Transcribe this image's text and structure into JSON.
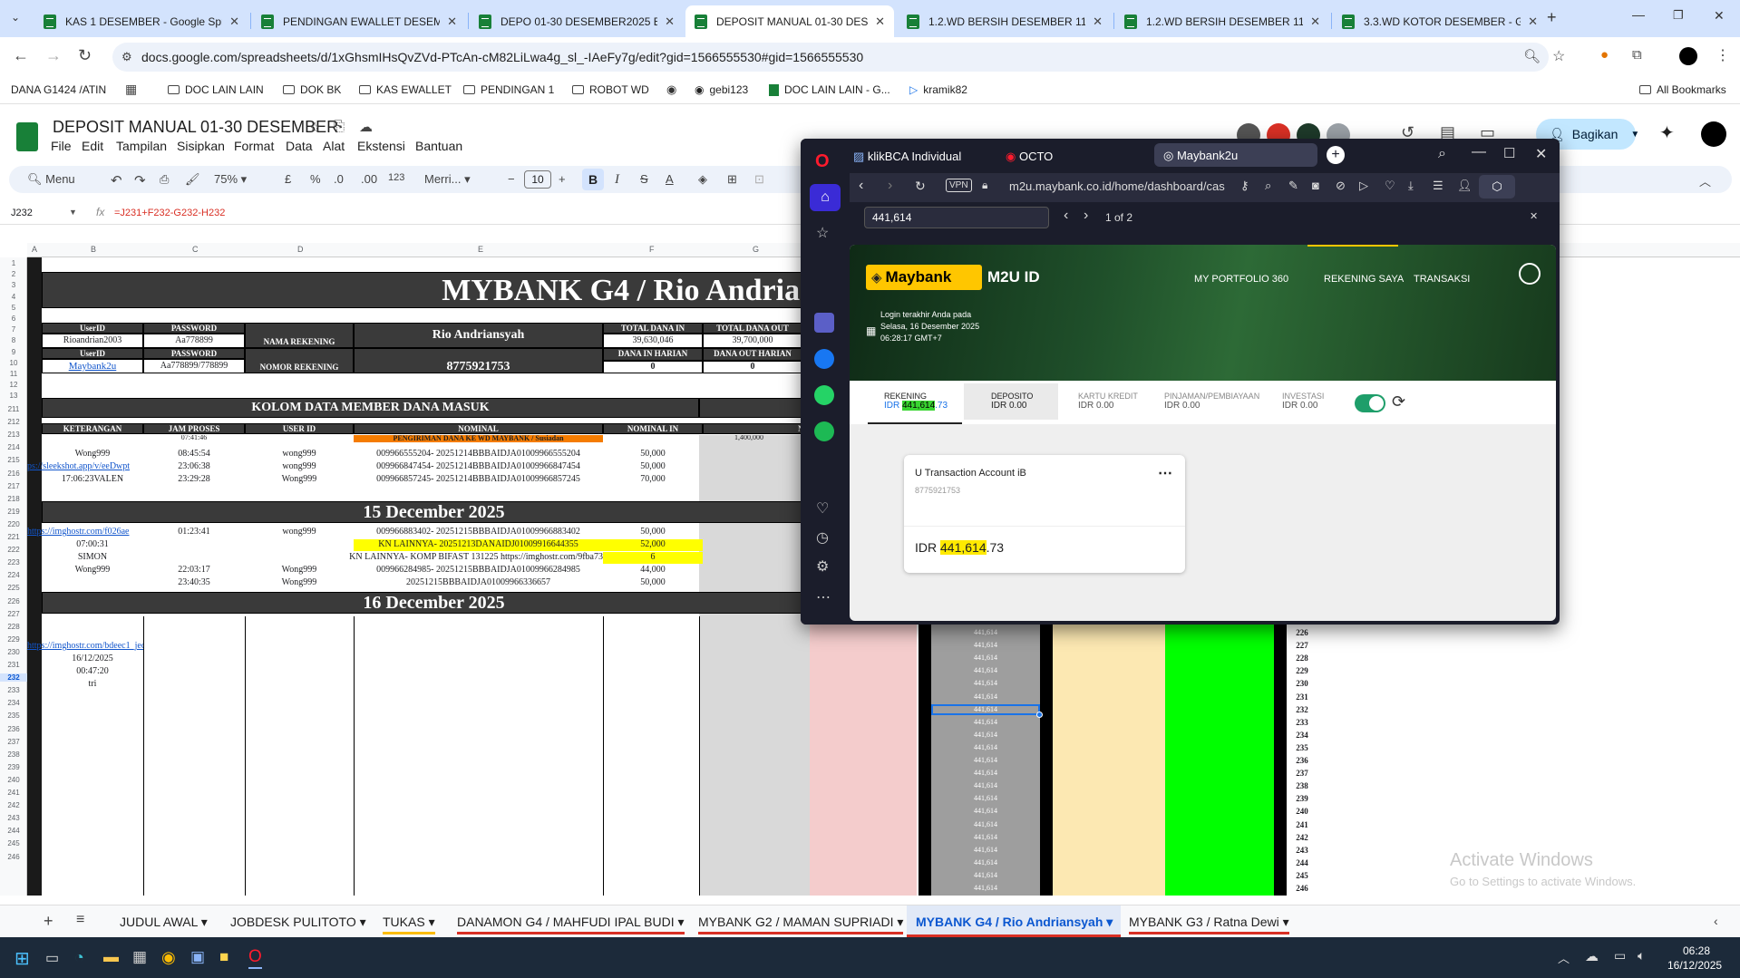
{
  "browser": {
    "tabs": [
      {
        "title": "KAS 1 DESEMBER - Google Spre"
      },
      {
        "title": "PENDINGAN EWALLET DESEMBE"
      },
      {
        "title": "DEPO 01-30 DESEMBER2025 BY"
      },
      {
        "title": "DEPOSIT MANUAL 01-30 DESEM"
      },
      {
        "title": "1.2.WD BERSIH DESEMBER 11 D"
      },
      {
        "title": "1.2.WD BERSIH DESEMBER 11 D"
      },
      {
        "title": "3.3.WD KOTOR DESEMBER - Go"
      }
    ],
    "url": "docs.google.com/spreadsheets/d/1xGhsmIHsQvZVd-PTcAn-cM82LiLwa4g_sl_-IAeFy7g/edit?gid=1566555530#gid=1566555530",
    "bookmarks": [
      "DANA G1424 /ATIN",
      "DOC LAIN LAIN",
      "DOK BK",
      "KAS EWALLET",
      "PENDINGAN 1",
      "ROBOT WD",
      "gebi123",
      "DOC LAIN LAIN - G...",
      "kramik82",
      "All Bookmarks"
    ]
  },
  "sheets": {
    "title": "DEPOSIT MANUAL 01-30 DESEMBER",
    "menu": [
      "File",
      "Edit",
      "Tampilan",
      "Sisipkan",
      "Format",
      "Data",
      "Alat",
      "Ekstensi",
      "Bantuan"
    ],
    "share_label": "Bagikan",
    "toolbar": {
      "menu": "Menu",
      "zoom": "75%",
      "currency": "£",
      "percent": "%",
      "dec_minus": ".0",
      "dec_plus": ".00",
      "number": "123",
      "font": "Merri...",
      "font_size": "10"
    },
    "cell_ref": "J232",
    "formula": "=J231+F232-G232-H232",
    "columns": [
      "A",
      "B",
      "C",
      "D",
      "E",
      "F",
      "G"
    ],
    "header": {
      "bank_title": "MYBANK G4 / Rio Andrian",
      "userid_label": "UserID",
      "password_label": "PASSWORD",
      "userid": "Rioandrian2003",
      "password": "Aa778899",
      "nama_label": "NAMA REKENING",
      "nama": "Rio Andriansyah",
      "total_in_label": "TOTAL DANA IN",
      "total_in": "39,630,046",
      "total_out_label": "TOTAL DANA OUT",
      "total_out": "39,700,000",
      "userid2_label": "UserID",
      "password2_label": "PASSWORD",
      "link": "Maybank2u",
      "password2": "Aa778899/778899",
      "nomor_label": "NOMOR REKENING",
      "nomor": "8775921753",
      "harian_in_label": "DANA IN HARIAN",
      "harian_in": "0",
      "harian_out_label": "DANA OUT HARIAN",
      "harian_out": "0"
    },
    "kolom_title": "KOLOM DATA MEMBER DANA MASUK",
    "col_labels": [
      "KETERANGAN",
      "JAM PROSES",
      "USER ID",
      "NOMINAL",
      "NOMINAL IN",
      "NOM"
    ],
    "rows_a": [
      {
        "b": "",
        "c": "07:41:46",
        "d": "",
        "e": "PENGIRIMAN DANA KE WD MAYBANK / Susiadan",
        "f": "",
        "g": "1,400,000"
      },
      {
        "b": "Wong999",
        "c": "08:45:54",
        "d": "wong999",
        "e": "009966555204- 20251214BBBAIDJA01009966555204",
        "f": "50,000",
        "g": ""
      },
      {
        "b": "ps://sleekshot.app/v/eeDwpt",
        "c": "23:06:38",
        "d": "wong999",
        "e": "009966847454- 20251214BBBAIDJA01009966847454",
        "f": "50,000",
        "g": ""
      },
      {
        "b": "17:06:23VALEN",
        "c": "23:29:28",
        "d": "Wong999",
        "e": "009966857245- 20251214BBBAIDJA01009966857245",
        "f": "70,000",
        "g": ""
      }
    ],
    "date1": "15 December 2025",
    "rows_b": [
      {
        "b": "https://imghostr.com/f026ae",
        "c": "01:23:41",
        "d": "wong999",
        "e": "009966883402- 20251215BBBAIDJA01009966883402",
        "f": "50,000"
      },
      {
        "b": "07:00:31",
        "c": "",
        "d": "",
        "e": "KN LAINNYA- 20251213DANAIDJ01009916644355",
        "f": "52,000"
      },
      {
        "b": "SIMON",
        "c": "",
        "d": "",
        "e": "KN LAINNYA- KOMP BIFAST 131225 https://imghostr.com/9fba73",
        "f": "6"
      },
      {
        "b": "Wong999",
        "c": "22:03:17",
        "d": "Wong999",
        "e": "009966284985- 20251215BBBAIDJA01009966284985",
        "f": "44,000"
      },
      {
        "b": "",
        "c": "23:40:35",
        "d": "Wong999",
        "e": "20251215BBBAIDJA01009966336657",
        "f": "50,000"
      }
    ],
    "date2": "16 December 2025",
    "rows_c": [
      {
        "b": "https://imghostr.com/bdeec1_jed"
      },
      {
        "b": "16/12/2025"
      },
      {
        "b": "00:47:20"
      },
      {
        "b": "tri"
      }
    ],
    "row_numbers": [
      "1",
      "2",
      "3",
      "4",
      "5",
      "6",
      "7",
      "8",
      "9",
      "10",
      "11",
      "12",
      "13",
      "211",
      "212",
      "213",
      "214",
      "215",
      "216",
      "217",
      "218",
      "219",
      "220",
      "221",
      "222",
      "223",
      "224",
      "225",
      "226",
      "227",
      "228",
      "229",
      "230",
      "231",
      "232",
      "233",
      "234",
      "235",
      "236",
      "237",
      "238",
      "239",
      "240",
      "241",
      "242",
      "243",
      "244",
      "245",
      "246"
    ],
    "saldo_value": "441,614",
    "right_numbers": [
      "226",
      "227",
      "228",
      "229",
      "230",
      "231",
      "232",
      "233",
      "234",
      "235",
      "236",
      "237",
      "238",
      "239",
      "240",
      "241",
      "242",
      "243",
      "244",
      "245",
      "246"
    ],
    "sheet_tabs": [
      "JUDUL AWAL",
      "JOBDESK PULITOTO",
      "TUKAS",
      "DANAMON G4 / MAHFUDI IPAL BUDI",
      "MYBANK G2 / MAMAN SUPRIADI",
      "MYBANK G4 / Rio Andriansyah",
      "MYBANK G3 / Ratna Dewi"
    ]
  },
  "opera": {
    "tabs": [
      "klikBCA Individual",
      "OCTO",
      "Maybank2u"
    ],
    "url": "m2u.maybank.co.id/home/dashboard/cas",
    "vpn": "VPN",
    "find_query": "441,614",
    "find_count": "1 of 2",
    "maybank": {
      "logo": "Maybank",
      "product": "M2U ID",
      "nav": [
        "MY PORTFOLIO 360",
        "REKENING SAYA",
        "TRANSAKSI"
      ],
      "login_label": "Login terakhir Anda pada",
      "login_date": "Selasa, 16 Desember 2025",
      "login_time": "06:28:17 GMT+7",
      "summary": [
        {
          "label": "REKENING",
          "pre": "IDR ",
          "hl": "441,614",
          "post": ".73"
        },
        {
          "label": "DEPOSITO",
          "value": "IDR 0.00"
        },
        {
          "label": "KARTU KREDIT",
          "value": "IDR 0.00"
        },
        {
          "label": "PINJAMAN/PEMBIAYAAN",
          "value": "IDR 0.00"
        },
        {
          "label": "INVESTASI",
          "value": "IDR 0.00"
        }
      ],
      "account": {
        "name": "U Transaction Account iB",
        "number": "8775921753",
        "pre": "IDR ",
        "hl": "441,614",
        "post": ".73"
      }
    }
  },
  "watermark": {
    "line1": "Activate Windows",
    "line2": "Go to Settings to activate Windows."
  },
  "taskbar": {
    "time": "06:28",
    "date": "16/12/2025"
  }
}
